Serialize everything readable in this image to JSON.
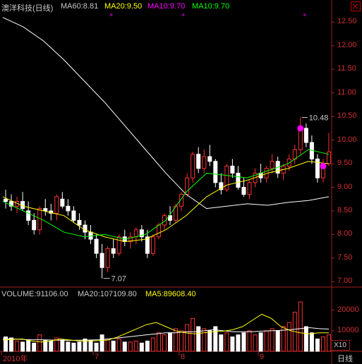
{
  "header": {
    "stock_name": "澳洋科技(日线)",
    "ma60": "MA60:8.81",
    "ma20": "MA20:9.50",
    "ma10": "MA10:9.70",
    "ma10b": "MA10:9.70"
  },
  "volume_header": {
    "volume": "VOLUME:91106.00",
    "ma20": "MA20:107109.80",
    "ma5": "MA5:89608.40"
  },
  "annotations": {
    "high_label": "10.48",
    "low_label": "7.07"
  },
  "footer": {
    "period_label": "日线",
    "zoom_label": "X10"
  },
  "colors": {
    "up": "#ff3232",
    "down": "#ffffff",
    "ma60": "#ffffff",
    "ma20": "#ffff00",
    "ma10": "#00ff00",
    "marker": "#ff00ff",
    "axis": "#a02020"
  },
  "chart_data": [
    {
      "type": "candlestick",
      "title": "澳洋科技(日线)",
      "y_axis_ticks": [
        "12.50",
        "12.00",
        "11.50",
        "11.00",
        "10.50",
        "10.00",
        "9.50",
        "9.00",
        "8.50",
        "8.00",
        "7.50",
        "7.00"
      ],
      "x_axis_ticks": [
        "2010年",
        "7",
        "8",
        "9"
      ],
      "ylim": [
        6.9,
        12.7
      ],
      "series": [
        {
          "name": "MA60",
          "values": [
            12.6,
            12.4,
            12.1,
            11.7,
            11.25,
            10.8,
            10.3,
            9.8,
            9.3,
            8.85,
            8.55,
            8.6,
            8.65,
            8.62,
            8.68,
            8.72,
            8.8
          ]
        },
        {
          "name": "MA20",
          "values": [
            8.8,
            8.6,
            8.5,
            8.4,
            8.1,
            7.95,
            7.85,
            7.9,
            8.1,
            8.4,
            8.8,
            9.05,
            9.15,
            9.3,
            9.4,
            9.55,
            9.5
          ]
        },
        {
          "name": "MA10",
          "values": [
            8.7,
            8.5,
            8.3,
            8.05,
            7.95,
            8.0,
            7.9,
            8.0,
            8.3,
            8.9,
            9.3,
            9.25,
            9.2,
            9.35,
            9.5,
            9.8,
            9.7
          ]
        }
      ],
      "candles": [
        [
          8.75,
          8.95,
          8.55,
          8.7
        ],
        [
          8.7,
          8.85,
          8.5,
          8.6
        ],
        [
          8.6,
          8.8,
          8.45,
          8.7
        ],
        [
          8.7,
          8.9,
          8.5,
          8.55
        ],
        [
          8.5,
          8.7,
          8.2,
          8.3
        ],
        [
          8.3,
          8.45,
          8.0,
          8.1
        ],
        [
          8.1,
          8.6,
          8.0,
          8.55
        ],
        [
          8.55,
          8.75,
          8.4,
          8.5
        ],
        [
          8.5,
          8.65,
          8.3,
          8.45
        ],
        [
          8.45,
          8.85,
          8.3,
          8.8
        ],
        [
          8.75,
          8.9,
          8.55,
          8.6
        ],
        [
          8.6,
          8.75,
          8.4,
          8.5
        ],
        [
          8.5,
          8.6,
          8.25,
          8.3
        ],
        [
          8.3,
          8.45,
          8.1,
          8.2
        ],
        [
          8.2,
          8.3,
          7.9,
          8.05
        ],
        [
          8.05,
          8.2,
          7.8,
          7.9
        ],
        [
          7.9,
          8.0,
          7.5,
          7.6
        ],
        [
          7.6,
          7.8,
          7.07,
          7.3
        ],
        [
          7.3,
          7.75,
          7.2,
          7.7
        ],
        [
          7.7,
          7.9,
          7.5,
          7.6
        ],
        [
          7.6,
          8.0,
          7.55,
          7.95
        ],
        [
          7.95,
          8.1,
          7.75,
          7.85
        ],
        [
          7.85,
          8.05,
          7.7,
          7.95
        ],
        [
          7.95,
          8.15,
          7.8,
          8.1
        ],
        [
          8.1,
          8.2,
          7.85,
          7.95
        ],
        [
          7.95,
          8.1,
          7.5,
          7.6
        ],
        [
          7.6,
          8.0,
          7.55,
          7.95
        ],
        [
          7.95,
          8.25,
          7.9,
          8.2
        ],
        [
          8.2,
          8.45,
          8.1,
          8.4
        ],
        [
          8.4,
          8.6,
          8.2,
          8.3
        ],
        [
          8.3,
          8.65,
          8.25,
          8.6
        ],
        [
          8.6,
          8.9,
          8.5,
          8.85
        ],
        [
          8.85,
          9.3,
          8.8,
          9.2
        ],
        [
          9.2,
          9.75,
          9.1,
          9.7
        ],
        [
          9.7,
          9.85,
          9.3,
          9.4
        ],
        [
          9.4,
          9.8,
          9.3,
          9.65
        ],
        [
          9.65,
          9.9,
          9.45,
          9.55
        ],
        [
          9.55,
          9.6,
          9.0,
          9.1
        ],
        [
          9.1,
          9.3,
          8.85,
          8.95
        ],
        [
          8.95,
          9.5,
          8.9,
          9.45
        ],
        [
          9.45,
          9.6,
          9.2,
          9.3
        ],
        [
          9.3,
          9.45,
          8.95,
          9.0
        ],
        [
          9.0,
          9.2,
          8.8,
          8.85
        ],
        [
          8.85,
          9.15,
          8.75,
          9.1
        ],
        [
          9.1,
          9.4,
          9.0,
          9.3
        ],
        [
          9.3,
          9.5,
          9.1,
          9.2
        ],
        [
          9.2,
          9.45,
          9.1,
          9.4
        ],
        [
          9.4,
          9.7,
          9.3,
          9.55
        ],
        [
          9.55,
          9.65,
          9.2,
          9.3
        ],
        [
          9.3,
          9.5,
          9.15,
          9.45
        ],
        [
          9.45,
          9.7,
          9.35,
          9.6
        ],
        [
          9.6,
          9.9,
          9.5,
          9.8
        ],
        [
          9.8,
          10.48,
          9.7,
          10.25
        ],
        [
          10.25,
          10.35,
          9.85,
          9.95
        ],
        [
          9.95,
          10.1,
          9.5,
          9.6
        ],
        [
          9.6,
          9.7,
          9.1,
          9.2
        ],
        [
          9.2,
          9.6,
          9.1,
          9.5
        ],
        [
          9.5,
          10.15,
          9.45,
          9.75
        ]
      ]
    },
    {
      "type": "bar",
      "title": "VOLUME",
      "y_axis_ticks": [
        "20000",
        "10000"
      ],
      "x_axis_ticks": [
        "2010年",
        "7",
        "8",
        "9"
      ],
      "ylim": [
        0,
        24000
      ],
      "values": [
        7000,
        6500,
        5000,
        4500,
        5500,
        4000,
        8000,
        5500,
        5000,
        6500,
        5500,
        4500,
        4000,
        4500,
        6000,
        5500,
        4000,
        8000,
        6000,
        5000,
        6000,
        4500,
        4500,
        5000,
        4000,
        5000,
        6500,
        9000,
        8000,
        9000,
        11000,
        10000,
        13000,
        16000,
        12000,
        11000,
        10000,
        12000,
        8000,
        9000,
        7000,
        8000,
        9000,
        10000,
        8000,
        9000,
        10000,
        11000,
        10000,
        12000,
        14000,
        19000,
        24000,
        12000,
        9000,
        6000,
        7000,
        8000
      ],
      "series": [
        {
          "name": "MA20",
          "values": [
            6000,
            6000,
            5800,
            5600,
            5600,
            5500,
            5400,
            5300,
            5400,
            5500,
            5600,
            6000,
            6500,
            7000,
            7500,
            8000,
            8500,
            9000,
            9000,
            9500,
            9500,
            10000,
            10500,
            10000,
            9500,
            9500,
            9500,
            9800,
            10000,
            10200,
            10500,
            11000,
            11500,
            11000,
            10800
          ]
        },
        {
          "name": "MA5",
          "values": [
            5500,
            5800,
            6000,
            5000,
            4500,
            5000,
            6000,
            5500,
            5000,
            5000,
            5200,
            5500,
            7000,
            9000,
            11000,
            13000,
            14000,
            12000,
            10000,
            9000,
            8500,
            9000,
            9500,
            9800,
            10500,
            12000,
            15000,
            18000,
            16000,
            12000,
            10000,
            9000,
            8500,
            9000,
            9000
          ]
        }
      ]
    }
  ]
}
